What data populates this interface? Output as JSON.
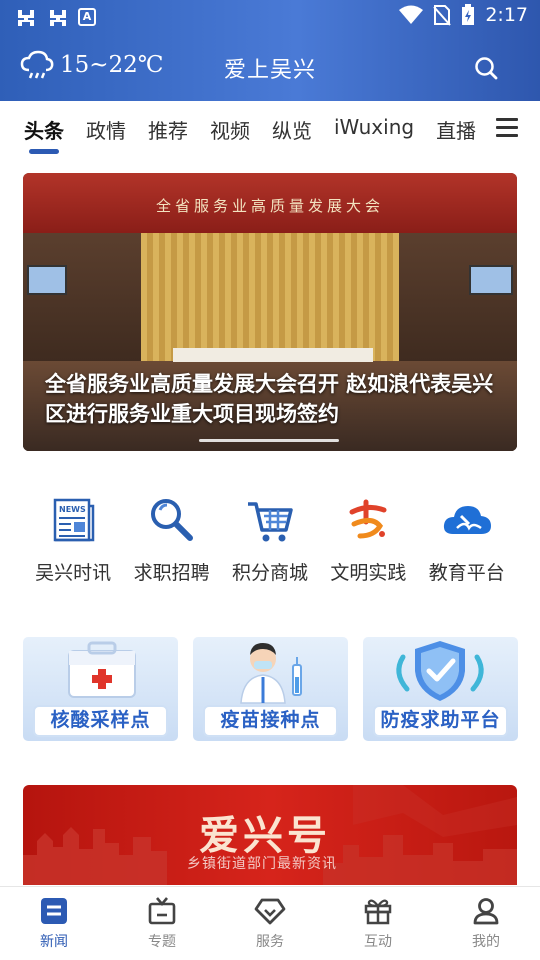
{
  "status_bar": {
    "left_icons": [
      "bug-icon",
      "bug-icon",
      "font-a-icon"
    ],
    "time": "2:17",
    "right_icons": [
      "wifi-icon",
      "no-sim-icon",
      "battery-charging-icon"
    ]
  },
  "header": {
    "weather": "15~22℃",
    "weather_icon": "cloud-rain-icon",
    "title": "爱上吴兴",
    "search_icon": "search-icon",
    "background": "#3563bf"
  },
  "tabs": {
    "items": [
      "头条",
      "政情",
      "推荐",
      "视频",
      "纵览",
      "iWuxing",
      "直播"
    ],
    "active_index": 0,
    "menu_icon": "menu-icon",
    "accent": "#2c5ab3"
  },
  "banner": {
    "hall_slogan": "全省服务业高质量发展大会",
    "caption": "全省服务业高质量发展大会召开 赵如浪代表吴兴区进行服务业重大项目现场签约"
  },
  "quick_links": [
    {
      "label": "吴兴时讯",
      "icon": "newspaper-icon"
    },
    {
      "label": "求职招聘",
      "icon": "magnifier-icon"
    },
    {
      "label": "积分商城",
      "icon": "shopping-cart-icon"
    },
    {
      "label": "文明实践",
      "icon": "volunteer-logo-icon"
    },
    {
      "label": "教育平台",
      "icon": "cloud-book-icon"
    }
  ],
  "service_cards": [
    {
      "label": "核酸采样点",
      "icon": "medical-kit-icon"
    },
    {
      "label": "疫苗接种点",
      "icon": "doctor-vaccine-icon"
    },
    {
      "label": "防疫求助平台",
      "icon": "shield-icon"
    }
  ],
  "promo": {
    "title": "爱兴号",
    "subtitle": "乡镇街道部门最新资讯"
  },
  "bottom_nav": {
    "items": [
      {
        "label": "新闻",
        "icon": "news-icon"
      },
      {
        "label": "专题",
        "icon": "tv-icon"
      },
      {
        "label": "服务",
        "icon": "diamond-icon"
      },
      {
        "label": "互动",
        "icon": "gift-icon"
      },
      {
        "label": "我的",
        "icon": "user-icon"
      }
    ],
    "active_index": 0
  }
}
